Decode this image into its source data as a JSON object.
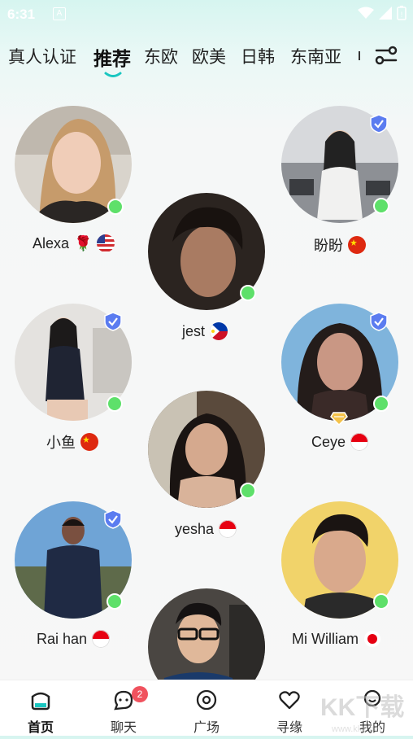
{
  "status_bar": {
    "time": "6:31",
    "notification_letter": "A"
  },
  "tabs": [
    {
      "label": "真人认证",
      "active": false
    },
    {
      "label": "推荐",
      "active": true
    },
    {
      "label": "东欧",
      "active": false
    },
    {
      "label": "欧美",
      "active": false
    },
    {
      "label": "日韩",
      "active": false
    },
    {
      "label": "东南亚",
      "active": false
    }
  ],
  "profiles": [
    {
      "name": "Alexa",
      "emoji": "🌹",
      "flag": "us",
      "verified": false,
      "online": true
    },
    {
      "name": "盼盼",
      "emoji": "",
      "flag": "cn",
      "verified": true,
      "online": true
    },
    {
      "name": "jest",
      "emoji": "",
      "flag": "ph",
      "verified": false,
      "online": true
    },
    {
      "name": "小鱼",
      "emoji": "",
      "flag": "cn",
      "verified": true,
      "online": true
    },
    {
      "name": "Ceye",
      "emoji": "",
      "flag": "id",
      "verified": true,
      "vip": true,
      "online": true
    },
    {
      "name": "yesha",
      "emoji": "",
      "flag": "id",
      "verified": false,
      "online": true
    },
    {
      "name": "Rai han",
      "emoji": "",
      "flag": "id",
      "verified": true,
      "online": true
    },
    {
      "name": "Mi William",
      "emoji": "",
      "flag": "jp",
      "verified": false,
      "online": true
    },
    {
      "name": "",
      "emoji": "",
      "flag": "",
      "verified": false,
      "online": false
    }
  ],
  "bottom_nav": [
    {
      "label": "首页",
      "icon": "home-icon",
      "active": true
    },
    {
      "label": "聊天",
      "icon": "chat-icon",
      "badge": "2"
    },
    {
      "label": "广场",
      "icon": "plaza-icon"
    },
    {
      "label": "寻缘",
      "icon": "heart-icon"
    },
    {
      "label": "我的",
      "icon": "profile-icon"
    }
  ],
  "watermark": {
    "text": "KK下载",
    "url": "www.kkx.net"
  },
  "colors": {
    "accent": "#19c6c0",
    "online": "#5ee06a",
    "verify": "#5b7cf0",
    "badge": "#f0525e"
  }
}
